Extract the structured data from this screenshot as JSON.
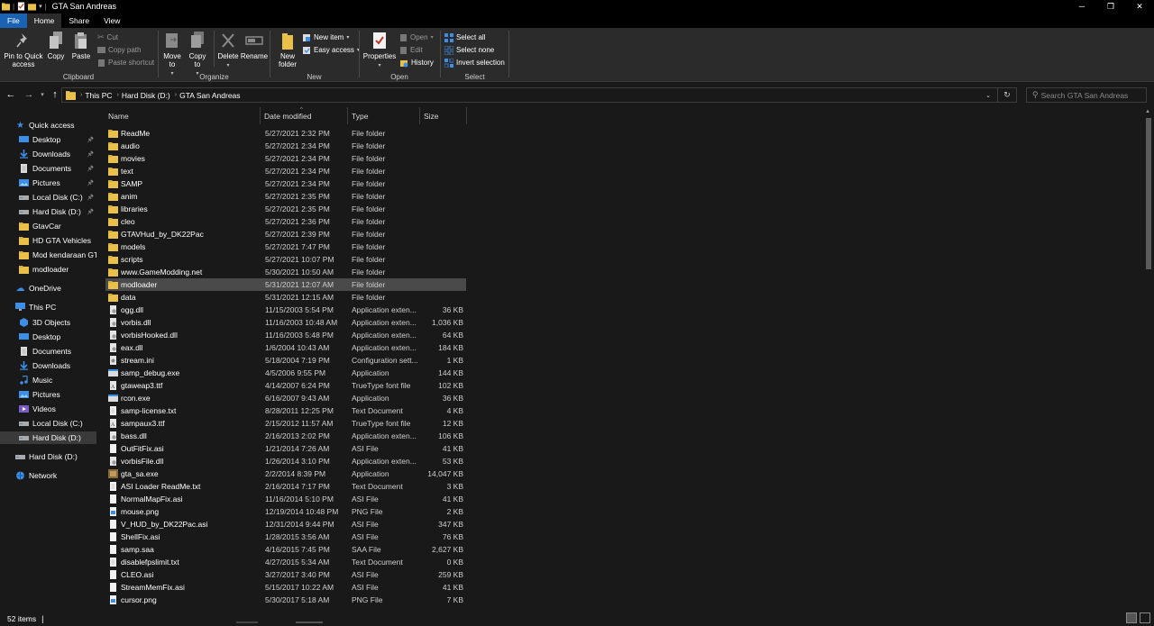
{
  "window": {
    "title": "GTA San Andreas",
    "controls": {
      "minimize": "─",
      "maximize": "❐",
      "close": "✕"
    }
  },
  "ribbon_tabs": [
    {
      "label": "File"
    },
    {
      "label": "Home"
    },
    {
      "label": "Share"
    },
    {
      "label": "View"
    }
  ],
  "ribbon": {
    "clipboard": {
      "pin_label": "Pin to Quick access",
      "copy_label": "Copy",
      "paste_label": "Paste",
      "cut_label": "Cut",
      "copy_path_label": "Copy path",
      "paste_shortcut_label": "Paste shortcut",
      "group_label": "Clipboard"
    },
    "organize": {
      "move_to_label": "Move to",
      "copy_to_label": "Copy to",
      "delete_label": "Delete",
      "rename_label": "Rename",
      "group_label": "Organize"
    },
    "new": {
      "new_folder_label": "New folder",
      "new_item_label": "New item",
      "easy_access_label": "Easy access",
      "group_label": "New"
    },
    "open": {
      "properties_label": "Properties",
      "open_label": "Open",
      "edit_label": "Edit",
      "history_label": "History",
      "group_label": "Open"
    },
    "select": {
      "select_all_label": "Select all",
      "select_none_label": "Select none",
      "invert_selection_label": "Invert selection",
      "group_label": "Select"
    }
  },
  "address": {
    "crumbs": [
      "This PC",
      "Hard Disk (D:)",
      "GTA San Andreas"
    ],
    "search_placeholder": "Search GTA San Andreas"
  },
  "nav_pane": {
    "quick_access": "Quick access",
    "quick_items": [
      {
        "label": "Desktop",
        "pinned": true,
        "icon": "desktop-icon"
      },
      {
        "label": "Downloads",
        "pinned": true,
        "icon": "downloads-icon"
      },
      {
        "label": "Documents",
        "pinned": true,
        "icon": "documents-icon"
      },
      {
        "label": "Pictures",
        "pinned": true,
        "icon": "pictures-icon"
      },
      {
        "label": "Local Disk (C:)",
        "pinned": true,
        "icon": "drive-icon"
      },
      {
        "label": "Hard Disk (D:)",
        "pinned": true,
        "icon": "drive-icon"
      },
      {
        "label": "GtavCar",
        "pinned": false,
        "icon": "folder-icon"
      },
      {
        "label": "HD GTA Vehicles",
        "pinned": false,
        "icon": "folder-icon"
      },
      {
        "label": "Mod kendaraan GTA",
        "pinned": false,
        "icon": "folder-icon"
      },
      {
        "label": "modloader",
        "pinned": false,
        "icon": "folder-icon"
      }
    ],
    "onedrive": "OneDrive",
    "this_pc": "This PC",
    "pc_items": [
      {
        "label": "3D Objects",
        "icon": "3d-objects-icon"
      },
      {
        "label": "Desktop",
        "icon": "desktop-icon"
      },
      {
        "label": "Documents",
        "icon": "documents-icon"
      },
      {
        "label": "Downloads",
        "icon": "downloads-icon"
      },
      {
        "label": "Music",
        "icon": "music-icon"
      },
      {
        "label": "Pictures",
        "icon": "pictures-icon"
      },
      {
        "label": "Videos",
        "icon": "videos-icon"
      },
      {
        "label": "Local Disk (C:)",
        "icon": "drive-icon"
      },
      {
        "label": "Hard Disk (D:)",
        "icon": "drive-icon"
      }
    ],
    "hard_disk_root": "Hard Disk (D:)",
    "network": "Network"
  },
  "columns": {
    "name": "Name",
    "date": "Date modified",
    "type": "Type",
    "size": "Size"
  },
  "files": [
    {
      "name": "ReadMe",
      "date": "5/27/2021 2:32 PM",
      "type": "File folder",
      "size": "",
      "icon": "folder"
    },
    {
      "name": "audio",
      "date": "5/27/2021 2:34 PM",
      "type": "File folder",
      "size": "",
      "icon": "folder"
    },
    {
      "name": "movies",
      "date": "5/27/2021 2:34 PM",
      "type": "File folder",
      "size": "",
      "icon": "folder"
    },
    {
      "name": "text",
      "date": "5/27/2021 2:34 PM",
      "type": "File folder",
      "size": "",
      "icon": "folder"
    },
    {
      "name": "SAMP",
      "date": "5/27/2021 2:34 PM",
      "type": "File folder",
      "size": "",
      "icon": "folder"
    },
    {
      "name": "anim",
      "date": "5/27/2021 2:35 PM",
      "type": "File folder",
      "size": "",
      "icon": "folder"
    },
    {
      "name": "libraries",
      "date": "5/27/2021 2:35 PM",
      "type": "File folder",
      "size": "",
      "icon": "folder"
    },
    {
      "name": "cleo",
      "date": "5/27/2021 2:36 PM",
      "type": "File folder",
      "size": "",
      "icon": "folder"
    },
    {
      "name": "GTAVHud_by_DK22Pac",
      "date": "5/27/2021 2:39 PM",
      "type": "File folder",
      "size": "",
      "icon": "folder"
    },
    {
      "name": "models",
      "date": "5/27/2021 7:47 PM",
      "type": "File folder",
      "size": "",
      "icon": "folder"
    },
    {
      "name": "scripts",
      "date": "5/27/2021 10:07 PM",
      "type": "File folder",
      "size": "",
      "icon": "folder"
    },
    {
      "name": "www.GameModding.net",
      "date": "5/30/2021 10:50 AM",
      "type": "File folder",
      "size": "",
      "icon": "folder"
    },
    {
      "name": "modloader",
      "date": "5/31/2021 12:07 AM",
      "type": "File folder",
      "size": "",
      "icon": "folder",
      "selected": true
    },
    {
      "name": "data",
      "date": "5/31/2021 12:15 AM",
      "type": "File folder",
      "size": "",
      "icon": "folder"
    },
    {
      "name": "ogg.dll",
      "date": "11/15/2003 5:54 PM",
      "type": "Application exten...",
      "size": "36 KB",
      "icon": "dll"
    },
    {
      "name": "vorbis.dll",
      "date": "11/16/2003 10:48 AM",
      "type": "Application exten...",
      "size": "1,036 KB",
      "icon": "dll"
    },
    {
      "name": "vorbisHooked.dll",
      "date": "11/16/2003 5:48 PM",
      "type": "Application exten...",
      "size": "64 KB",
      "icon": "dll"
    },
    {
      "name": "eax.dll",
      "date": "1/6/2004 10:43 AM",
      "type": "Application exten...",
      "size": "184 KB",
      "icon": "dll"
    },
    {
      "name": "stream.ini",
      "date": "5/18/2004 7:19 PM",
      "type": "Configuration sett...",
      "size": "1 KB",
      "icon": "ini"
    },
    {
      "name": "samp_debug.exe",
      "date": "4/5/2006 9:55 PM",
      "type": "Application",
      "size": "144 KB",
      "icon": "exe"
    },
    {
      "name": "gtaweap3.ttf",
      "date": "4/14/2007 6:24 PM",
      "type": "TrueType font file",
      "size": "102 KB",
      "icon": "font"
    },
    {
      "name": "rcon.exe",
      "date": "6/16/2007 9:43 AM",
      "type": "Application",
      "size": "36 KB",
      "icon": "exe"
    },
    {
      "name": "samp-license.txt",
      "date": "8/28/2011 12:25 PM",
      "type": "Text Document",
      "size": "4 KB",
      "icon": "txt"
    },
    {
      "name": "sampaux3.ttf",
      "date": "2/15/2012 11:57 AM",
      "type": "TrueType font file",
      "size": "12 KB",
      "icon": "font"
    },
    {
      "name": "bass.dll",
      "date": "2/16/2013 2:02 PM",
      "type": "Application exten...",
      "size": "106 KB",
      "icon": "dll"
    },
    {
      "name": "OutFitFix.asi",
      "date": "1/21/2014 7:26 AM",
      "type": "ASI File",
      "size": "41 KB",
      "icon": "blank"
    },
    {
      "name": "vorbisFile.dll",
      "date": "1/26/2014 3:10 PM",
      "type": "Application exten...",
      "size": "53 KB",
      "icon": "dll"
    },
    {
      "name": "gta_sa.exe",
      "date": "2/2/2014 8:39 PM",
      "type": "Application",
      "size": "14,047 KB",
      "icon": "gta"
    },
    {
      "name": "ASI Loader ReadMe.txt",
      "date": "2/16/2014 7:17 PM",
      "type": "Text Document",
      "size": "3 KB",
      "icon": "txt"
    },
    {
      "name": "NormalMapFix.asi",
      "date": "11/16/2014 5:10 PM",
      "type": "ASI File",
      "size": "41 KB",
      "icon": "blank"
    },
    {
      "name": "mouse.png",
      "date": "12/19/2014 10:48 PM",
      "type": "PNG File",
      "size": "2 KB",
      "icon": "png"
    },
    {
      "name": "V_HUD_by_DK22Pac.asi",
      "date": "12/31/2014 9:44 PM",
      "type": "ASI File",
      "size": "347 KB",
      "icon": "blank"
    },
    {
      "name": "ShellFix.asi",
      "date": "1/28/2015 3:56 AM",
      "type": "ASI File",
      "size": "76 KB",
      "icon": "blank"
    },
    {
      "name": "samp.saa",
      "date": "4/16/2015 7:45 PM",
      "type": "SAA File",
      "size": "2,627 KB",
      "icon": "blank"
    },
    {
      "name": "disablefpslimit.txt",
      "date": "4/27/2015 5:34 AM",
      "type": "Text Document",
      "size": "0 KB",
      "icon": "txt"
    },
    {
      "name": "CLEO.asi",
      "date": "3/27/2017 3:40 PM",
      "type": "ASI File",
      "size": "259 KB",
      "icon": "blank"
    },
    {
      "name": "StreamMemFix.asi",
      "date": "5/15/2017 10:22 AM",
      "type": "ASI File",
      "size": "41 KB",
      "icon": "blank"
    },
    {
      "name": "cursor.png",
      "date": "5/30/2017 5:18 AM",
      "type": "PNG File",
      "size": "7 KB",
      "icon": "png"
    }
  ],
  "status": {
    "item_count": "52 items"
  },
  "colors": {
    "background": "#191919",
    "ribbon": "#2b2b2b",
    "file_tab": "#1a63b4",
    "folder": "#e8c04a",
    "selection": "#4a4a4a",
    "accent_blue": "#3c8ee6"
  }
}
